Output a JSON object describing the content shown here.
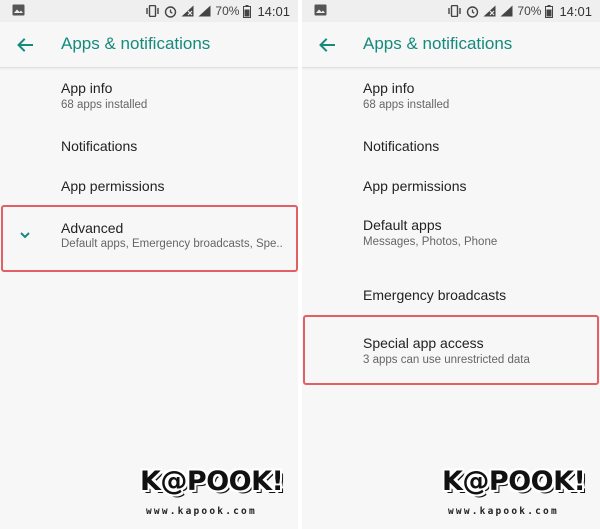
{
  "status_bar": {
    "battery_percent": "70%",
    "time": "14:01",
    "icons": [
      "image-icon",
      "vibrate-icon",
      "alarm-icon",
      "wifi-icon",
      "signal-icon",
      "battery-icon"
    ]
  },
  "left_panel": {
    "title": "Apps & notifications",
    "items": [
      {
        "title": "App info",
        "subtitle": "68 apps installed"
      },
      {
        "title": "Notifications"
      },
      {
        "title": "App permissions"
      },
      {
        "title": "Advanced",
        "subtitle": "Default apps, Emergency broadcasts, Spe.."
      }
    ]
  },
  "right_panel": {
    "title": "Apps & notifications",
    "items": [
      {
        "title": "App info",
        "subtitle": "68 apps installed"
      },
      {
        "title": "Notifications"
      },
      {
        "title": "App permissions"
      },
      {
        "title": "Default apps",
        "subtitle": "Messages, Photos, Phone"
      },
      {
        "title": "Emergency broadcasts"
      },
      {
        "title": "Special app access",
        "subtitle": "3 apps can use unrestricted data"
      }
    ]
  },
  "watermark": {
    "logo": "K@POOK!",
    "url": "www.kapook.com"
  },
  "colors": {
    "accent": "#168a7d",
    "highlight": "#e25f66",
    "background": "#f7f7f7"
  }
}
